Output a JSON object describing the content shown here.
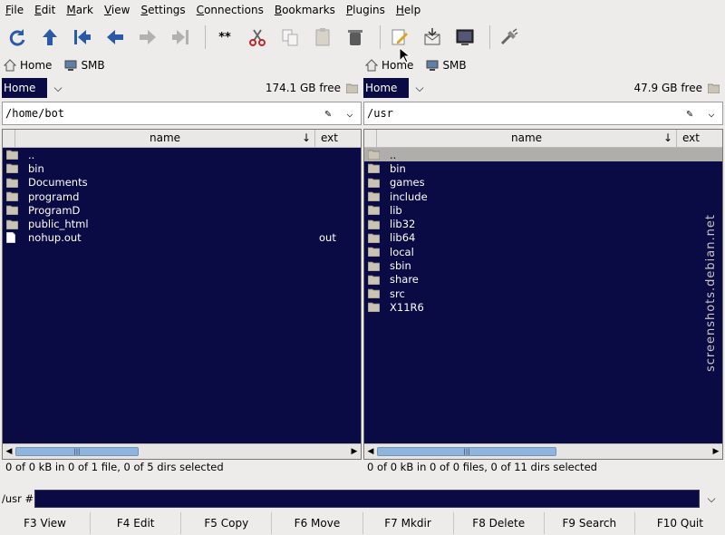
{
  "menu": [
    "File",
    "Edit",
    "Mark",
    "View",
    "Settings",
    "Connections",
    "Bookmarks",
    "Plugins",
    "Help"
  ],
  "toolbar": {
    "buttons": [
      "refresh-icon",
      "up-arrow-icon",
      "first-icon",
      "back-arrow-icon",
      "forward-arrow-icon",
      "last-icon",
      "wildcard-icon",
      "cut-icon",
      "copy-icon",
      "paste-icon",
      "trash-icon",
      "edit-icon",
      "mail-icon",
      "terminal-icon",
      "plug-icon"
    ],
    "wildcard_label": "**"
  },
  "left": {
    "bookmarks": [
      "Home",
      "SMB"
    ],
    "drive": "Home",
    "free": "174.1 GB free",
    "path": "/home/bot",
    "columns": {
      "name": "name",
      "sort": "↓",
      "ext": "ext"
    },
    "rows": [
      {
        "name": "..",
        "ext": "",
        "type": "folder"
      },
      {
        "name": "bin",
        "ext": "",
        "type": "folder"
      },
      {
        "name": "Documents",
        "ext": "",
        "type": "folder"
      },
      {
        "name": "programd",
        "ext": "",
        "type": "folder"
      },
      {
        "name": "ProgramD",
        "ext": "",
        "type": "folder"
      },
      {
        "name": "public_html",
        "ext": "",
        "type": "folder"
      },
      {
        "name": "nohup.out",
        "ext": "out",
        "type": "file"
      }
    ],
    "status": "0  of 0  kB in 0 of 1 file, 0 of 5 dirs selected",
    "hscroll": 0.37
  },
  "right": {
    "bookmarks": [
      "Home",
      "SMB"
    ],
    "drive": "Home",
    "free": "47.9 GB free",
    "path": "/usr",
    "columns": {
      "name": "name",
      "sort": "↓",
      "ext": "ext"
    },
    "rows": [
      {
        "name": "..",
        "ext": "",
        "type": "folder",
        "current": true
      },
      {
        "name": "bin",
        "ext": "",
        "type": "folder"
      },
      {
        "name": "games",
        "ext": "",
        "type": "folder"
      },
      {
        "name": "include",
        "ext": "",
        "type": "folder"
      },
      {
        "name": "lib",
        "ext": "",
        "type": "folder"
      },
      {
        "name": "lib32",
        "ext": "",
        "type": "folder"
      },
      {
        "name": "lib64",
        "ext": "",
        "type": "folder"
      },
      {
        "name": "local",
        "ext": "",
        "type": "folder"
      },
      {
        "name": "sbin",
        "ext": "",
        "type": "folder"
      },
      {
        "name": "share",
        "ext": "",
        "type": "folder"
      },
      {
        "name": "src",
        "ext": "",
        "type": "folder"
      },
      {
        "name": "X11R6",
        "ext": "",
        "type": "folder"
      }
    ],
    "status": "0  of 0  kB in 0 of 0 files, 0 of 11 dirs selected",
    "hscroll": 0.54
  },
  "cmdline": {
    "prompt": "/usr #",
    "value": ""
  },
  "fkeys": [
    "F3 View",
    "F4 Edit",
    "F5 Copy",
    "F6 Move",
    "F7 Mkdir",
    "F8 Delete",
    "F9 Search",
    "F10 Quit"
  ],
  "watermark": "screenshots.debian.net"
}
